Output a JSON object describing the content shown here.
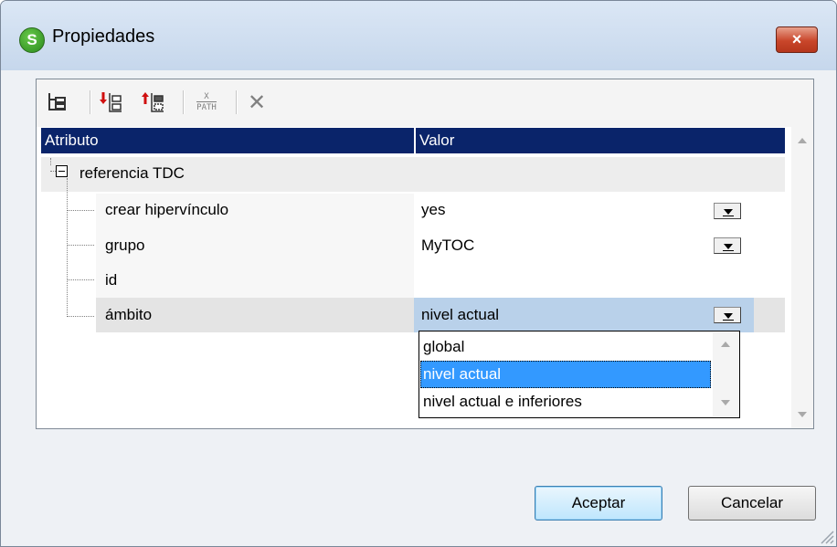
{
  "window": {
    "title": "Propiedades",
    "close_label": "×",
    "app_icon_letter": "S"
  },
  "toolbar": {
    "icons": [
      "tree-view-icon",
      "add-child-icon",
      "add-sibling-icon",
      "xpath-icon",
      "delete-icon"
    ],
    "xpath_top": "X",
    "xpath_bottom": "PATH",
    "delete_glyph": "✕"
  },
  "grid": {
    "headers": {
      "attribute": "Atributo",
      "value": "Valor"
    },
    "group": {
      "label": "referencia TDC",
      "expand_glyph": "⊟"
    },
    "rows": [
      {
        "name": "crear hipervínculo",
        "value": "yes"
      },
      {
        "name": "grupo",
        "value": "MyTOC"
      },
      {
        "name": "id",
        "value": ""
      },
      {
        "name": "ámbito",
        "value": "nivel actual"
      }
    ]
  },
  "dropdown": {
    "options": [
      "global",
      "nivel actual",
      "nivel actual e inferiores"
    ],
    "selected": "nivel actual"
  },
  "buttons": {
    "ok": "Aceptar",
    "cancel": "Cancelar"
  },
  "colors": {
    "header_bg": "#0a246a",
    "selected_row": "#b9d1ea",
    "list_selected": "#3399ff"
  }
}
